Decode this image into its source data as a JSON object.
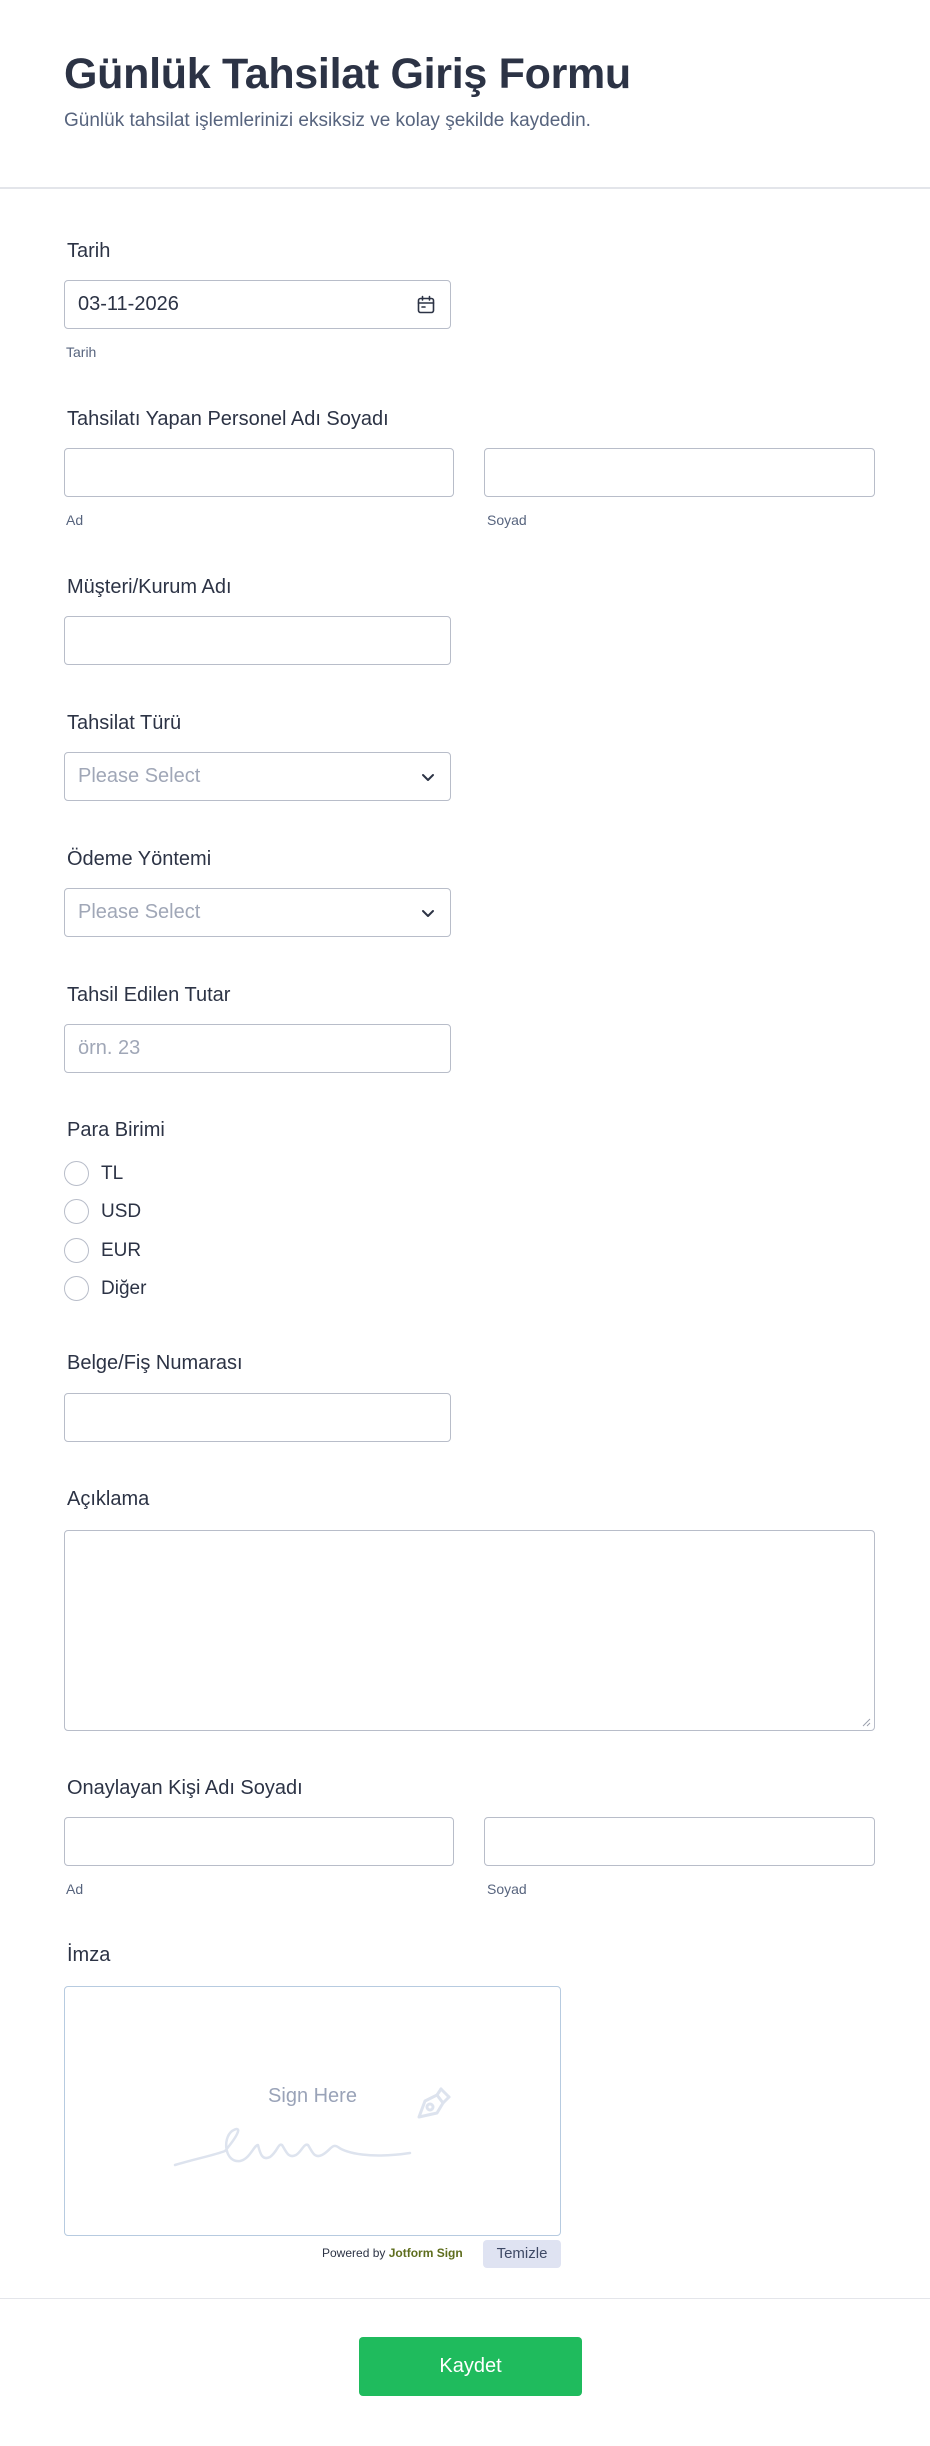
{
  "header": {
    "title": "Günlük Tahsilat Giriş Formu",
    "subtitle": "Günlük tahsilat işlemlerinizi eksiksiz ve kolay şekilde kaydedin."
  },
  "fields": {
    "date": {
      "label": "Tarih",
      "value": "03-11-2026",
      "sublabel": "Tarih",
      "icon": "calendar-icon"
    },
    "collector_name": {
      "label": "Tahsilatı Yapan Personel Adı Soyadı",
      "first_sublabel": "Ad",
      "last_sublabel": "Soyad",
      "first_value": "",
      "last_value": ""
    },
    "customer": {
      "label": "Müşteri/Kurum Adı",
      "value": ""
    },
    "collection_type": {
      "label": "Tahsilat Türü",
      "selected": "Please Select",
      "icon": "chevron-down-icon"
    },
    "payment_method": {
      "label": "Ödeme Yöntemi",
      "selected": "Please Select",
      "icon": "chevron-down-icon"
    },
    "amount": {
      "label": "Tahsil Edilen Tutar",
      "placeholder": "örn. 23"
    },
    "currency": {
      "label": "Para Birimi",
      "options": [
        "TL",
        "USD",
        "EUR",
        "Diğer"
      ]
    },
    "receipt_no": {
      "label": "Belge/Fiş Numarası",
      "value": ""
    },
    "description": {
      "label": "Açıklama",
      "value": ""
    },
    "approver_name": {
      "label": "Onaylayan Kişi Adı Soyadı",
      "first_sublabel": "Ad",
      "last_sublabel": "Soyad",
      "first_value": "",
      "last_value": ""
    },
    "signature": {
      "label": "İmza",
      "hint": "Sign Here",
      "powered_by": "Powered by",
      "brand": "Jotform Sign",
      "clear_label": "Temizle",
      "icon": "pen-nib-icon"
    }
  },
  "submit": {
    "label": "Kaydet"
  },
  "colors": {
    "submit_bg": "#1fbb5d",
    "text_primary": "#2c3345",
    "text_secondary": "#57647e",
    "border": "#b8bdc9",
    "placeholder": "#a0a7b7",
    "clear_bg": "#dfe3f2"
  }
}
